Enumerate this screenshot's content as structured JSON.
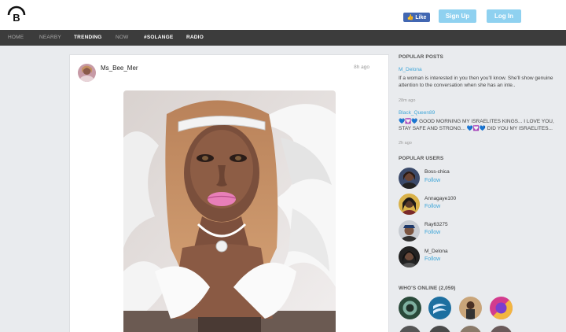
{
  "header": {
    "fb_like": "Like",
    "signup": "Sign Up",
    "login": "Log In"
  },
  "nav": [
    {
      "label": "HOME"
    },
    {
      "label": "NEARBY"
    },
    {
      "label": "TRENDING"
    },
    {
      "label": "NOW"
    },
    {
      "label": "#SOLANGE"
    },
    {
      "label": "RADIO"
    }
  ],
  "post": {
    "username": "Ms_Bee_Mer",
    "time": "8h ago"
  },
  "sidebar": {
    "popular_posts_heading": "POPULAR POSTS",
    "popular_posts": [
      {
        "user": "M_Delona",
        "text": "If a woman is interested in you then you'll know. She'll show genuine attention to the conversation when she has an inte..",
        "time": "28m ago"
      },
      {
        "user": "Black_Queen89",
        "text": "💙💟💙 GOOD MORNING MY ISRAELITES KINGS... I LOVE YOU, STAY SAFE AND STRONG... 💙💟💙 DID YOU MY ISRAELITES...",
        "time": "2h ago"
      }
    ],
    "popular_users_heading": "POPULAR USERS",
    "popular_users": [
      {
        "name": "Boss-chica",
        "follow": "Follow"
      },
      {
        "name": "Annagaye100",
        "follow": "Follow"
      },
      {
        "name": "Ray63275",
        "follow": "Follow"
      },
      {
        "name": "M_Delona",
        "follow": "Follow"
      }
    ],
    "whos_online_heading": "WHO'S ONLINE (2,059)"
  },
  "colors": {
    "accent": "#3ea6d8",
    "button": "#8fd1f0",
    "nav_bg": "#3c3c3c",
    "page_bg": "#e9ebee",
    "fb_blue": "#4267b2"
  }
}
